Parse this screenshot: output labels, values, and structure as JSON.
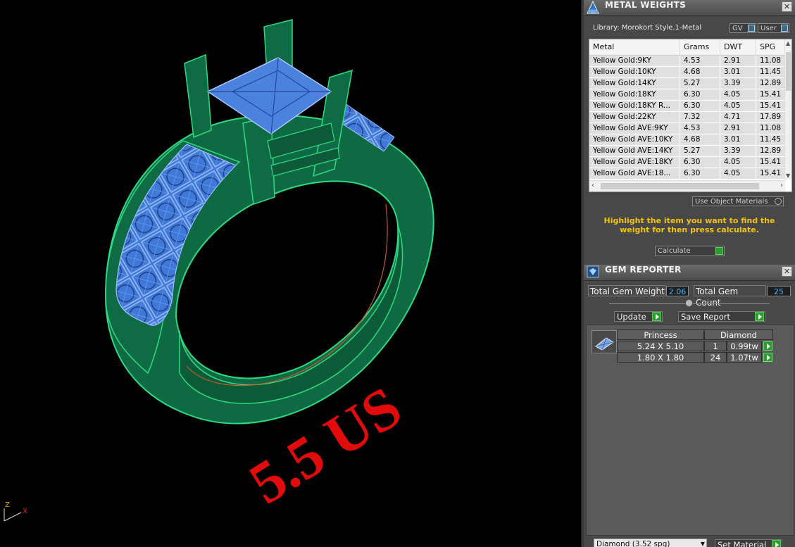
{
  "viewport": {
    "size_label": "5.5 US",
    "axes": {
      "z": "Z",
      "x": "X"
    },
    "colors": {
      "metal": "#0f6b44",
      "metal_edge": "#2fd983",
      "gem": "#3f78d6",
      "gem_edge": "#8fb3ff",
      "label": "#e10b0b"
    }
  },
  "metal_weights": {
    "title": "METAL WEIGHTS",
    "library": "Library: Morokort Style.1-Metal",
    "toggles": [
      "GV",
      "User"
    ],
    "columns": [
      "Metal",
      "Grams",
      "DWT",
      "SPG"
    ],
    "rows": [
      [
        "Yellow Gold:9KY",
        "4.53",
        "2.91",
        "11.08"
      ],
      [
        "Yellow Gold:10KY",
        "4.68",
        "3.01",
        "11.45"
      ],
      [
        "Yellow Gold:14KY",
        "5.27",
        "3.39",
        "12.89"
      ],
      [
        "Yellow Gold:18KY",
        "6.30",
        "4.05",
        "15.41"
      ],
      [
        "Yellow Gold:18KY R...",
        "6.30",
        "4.05",
        "15.41"
      ],
      [
        "Yellow Gold:22KY",
        "7.32",
        "4.71",
        "17.89"
      ],
      [
        "Yellow Gold AVE:9KY",
        "4.53",
        "2.91",
        "11.08"
      ],
      [
        "Yellow Gold AVE:10KY",
        "4.68",
        "3.01",
        "11.45"
      ],
      [
        "Yellow Gold AVE:14KY",
        "5.27",
        "3.39",
        "12.89"
      ],
      [
        "Yellow Gold AVE:18KY",
        "6.30",
        "4.05",
        "15.41"
      ],
      [
        "Yellow Gold AVE:18...",
        "6.30",
        "4.05",
        "15.41"
      ]
    ],
    "use_object_materials": "Use Object Materials",
    "hint": "Highlight the item you want to find the weight for then press calculate.",
    "calculate": "Calculate"
  },
  "gem_reporter": {
    "title": "GEM REPORTER",
    "total_weight_label": "Total Gem Weight",
    "total_weight": "2.06",
    "total_count_label": "Total Gem Count",
    "total_count": "25",
    "update": "Update",
    "save_report": "Save Report",
    "group": {
      "cut": "Princess",
      "type": "Diamond"
    },
    "gems": [
      {
        "size": "5.24 X 5.10",
        "count": "1",
        "weight": "0.99tw"
      },
      {
        "size": "1.80 X 1.80",
        "count": "24",
        "weight": "1.07tw"
      }
    ],
    "material_select": "Diamond (3.52 spg)",
    "set_material": "Set Material"
  }
}
